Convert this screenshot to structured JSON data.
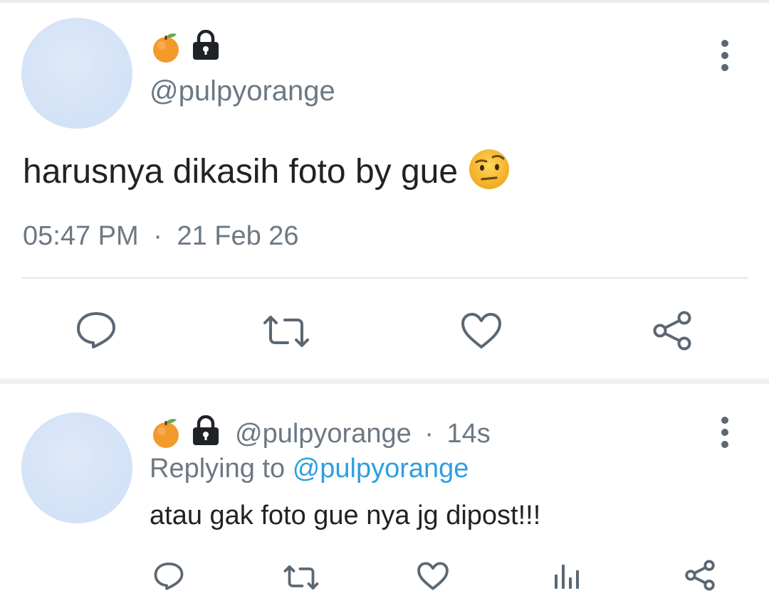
{
  "colors": {
    "text": "#202326",
    "muted": "#6c7883",
    "link": "#2f9fe0",
    "icon": "#5b6773",
    "divider": "#e3e7eb"
  },
  "main_post": {
    "display_emojis": [
      "orange-emoji",
      "lock-emoji"
    ],
    "handle": "@pulpyorange",
    "text": "harusnya dikasih foto by gue",
    "text_emoji": "face-with-raised-eyebrow-emoji",
    "time": "05:47 PM",
    "separator": "·",
    "date": "21 Feb 26",
    "actions": [
      "reply-icon",
      "retweet-icon",
      "like-icon",
      "share-icon"
    ]
  },
  "reply_post": {
    "display_emojis": [
      "orange-emoji",
      "lock-emoji"
    ],
    "handle": "@pulpyorange",
    "separator": "·",
    "age": "14s",
    "replying_prefix": "Replying to",
    "replying_handle": "@pulpyorange",
    "text": "atau gak foto gue nya jg dipost!!!",
    "actions": [
      "reply-icon",
      "retweet-icon",
      "like-icon",
      "stats-icon",
      "share-icon"
    ]
  }
}
